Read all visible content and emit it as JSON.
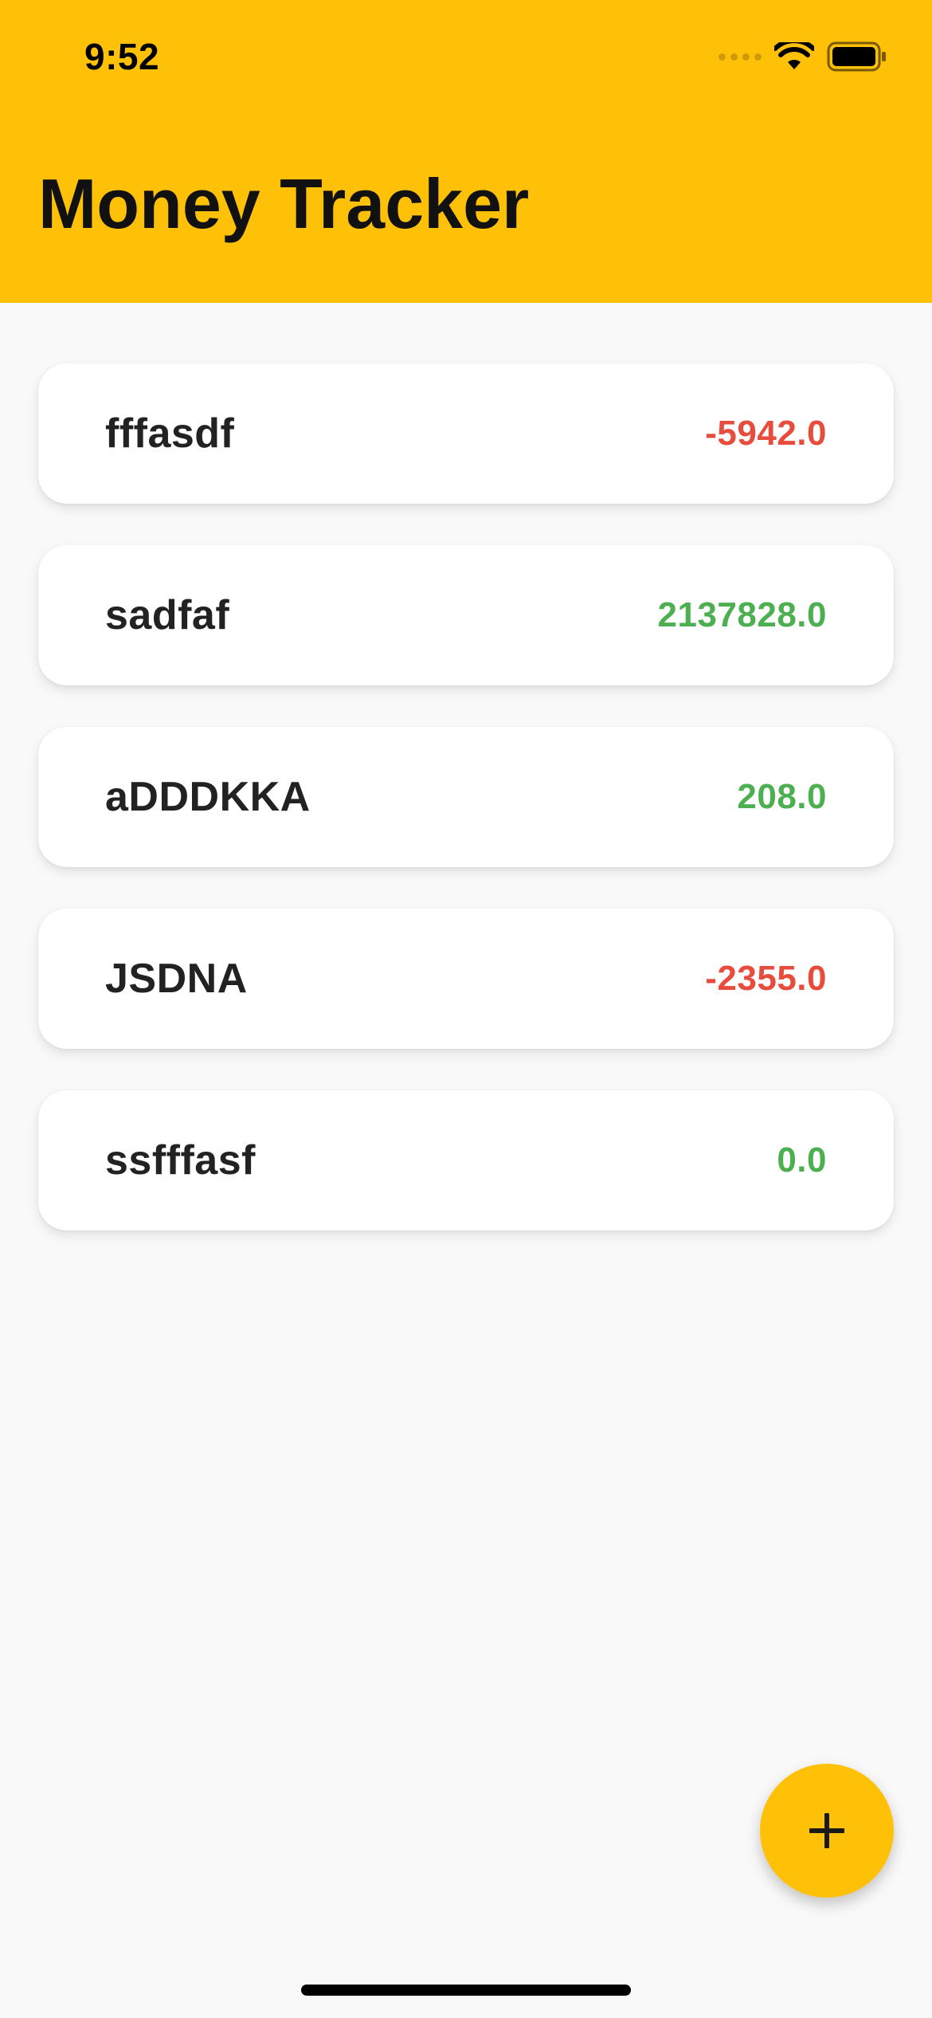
{
  "status_bar": {
    "time": "9:52",
    "icons": [
      "cellular-signal-icon",
      "wifi-icon",
      "battery-icon"
    ]
  },
  "app_bar": {
    "title": "Money Tracker",
    "color": "#FFC107"
  },
  "transactions": [
    {
      "name": "fffasdf",
      "amount": "-5942.0",
      "sign": "negative"
    },
    {
      "name": "sadfaf",
      "amount": "2137828.0",
      "sign": "positive"
    },
    {
      "name": "aDDDKKA",
      "amount": "208.0",
      "sign": "positive"
    },
    {
      "name": "JSDNA",
      "amount": "-2355.0",
      "sign": "negative"
    },
    {
      "name": "ssfffasf",
      "amount": "0.0",
      "sign": "positive"
    }
  ],
  "colors": {
    "negative": "#E74C3C",
    "positive": "#4CAF50",
    "accent": "#FFC107"
  },
  "fab": {
    "icon": "plus-icon"
  }
}
